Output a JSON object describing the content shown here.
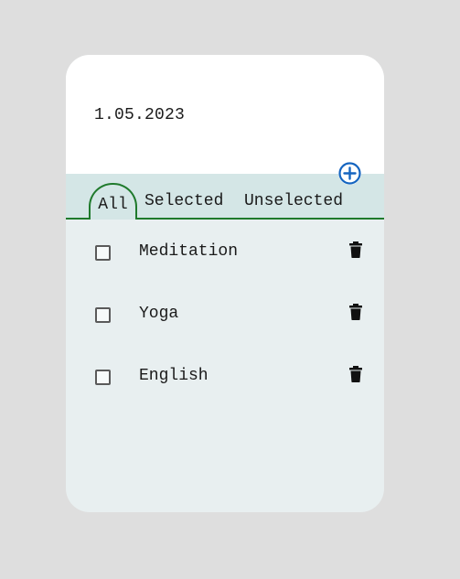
{
  "header": {
    "date": "1.05.2023"
  },
  "tabs": [
    {
      "label": "All",
      "active": true
    },
    {
      "label": "Selected",
      "active": false
    },
    {
      "label": "Unselected",
      "active": false
    }
  ],
  "tasks": [
    {
      "label": "Meditation",
      "checked": false
    },
    {
      "label": "Yoga",
      "checked": false
    },
    {
      "label": "English",
      "checked": false
    }
  ],
  "icons": {
    "add": "add-circle-icon",
    "delete": "trash-icon"
  },
  "colors": {
    "accent": "#1f7a2c",
    "add_button": "#1565c0",
    "tabbar_bg": "#d4e6e6",
    "list_bg": "#e8eff0",
    "page_bg": "#dedede"
  }
}
